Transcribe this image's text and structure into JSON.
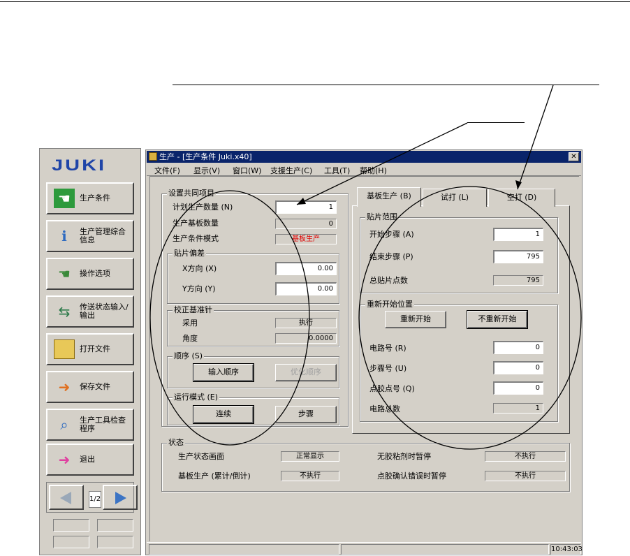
{
  "sidebar": {
    "logo": "JUKI",
    "buttons": [
      {
        "label": "生产条件",
        "icon": "production-conditions-icon"
      },
      {
        "label": "生产管理综合信息",
        "icon": "production-info-icon"
      },
      {
        "label": "操作选项",
        "icon": "operation-options-icon"
      },
      {
        "label": "传送状态输入/输出",
        "icon": "transfer-status-icon"
      },
      {
        "label": "打开文件",
        "icon": "folder-open-icon"
      },
      {
        "label": "保存文件",
        "icon": "save-file-icon"
      },
      {
        "label": "生产工具检查程序",
        "icon": "tool-check-icon"
      },
      {
        "label": "退出",
        "icon": "exit-door-icon"
      }
    ],
    "page_indicator": "1/2"
  },
  "window": {
    "title": "生产 - [生产条件 Juki.x40]",
    "menu": [
      "文件(F)",
      "显示(V)",
      "窗口(W)",
      "支援生产(C)",
      "工具(T)",
      "帮助(H)"
    ]
  },
  "common": {
    "title": "设置共同项目",
    "planned_qty_label": "计划生产数量 (N)",
    "planned_qty_value": "1",
    "board_qty_label": "生产基板数量",
    "board_qty_value": "0",
    "mode_label": "生产条件模式",
    "mode_value": "基板生产",
    "mode_color": "#e00000",
    "offset": {
      "title": "贴片偏差",
      "x_label": "X方向 (X)",
      "x_value": "0.00",
      "y_label": "Y方向 (Y)",
      "y_value": "0.00"
    },
    "pin": {
      "title": "校正基准针",
      "use_label": "采用",
      "use_value": "执行",
      "angle_label": "角度",
      "angle_value": "0.0000"
    },
    "order": {
      "title": "顺序 (S)",
      "input_btn": "输入顺序",
      "optimize_btn": "优化顺序"
    },
    "run_mode": {
      "title": "运行模式 (E)",
      "continuous_btn": "连续",
      "step_btn": "步骤"
    }
  },
  "tabs": [
    "基板生产 (B)",
    "试打 (L)",
    "空打 (D)"
  ],
  "placement": {
    "range_title": "贴片范围",
    "start_label": "开始步骤 (A)",
    "start_value": "1",
    "end_label": "结束步骤 (P)",
    "end_value": "795",
    "total_label": "总贴片点数",
    "total_value": "795",
    "restart_title": "重新开始位置",
    "restart_btn": "重新开始",
    "no_restart_btn": "不重新开始",
    "circuit_label": "电路号 (R)",
    "circuit_value": "0",
    "step_label": "步骤号 (U)",
    "step_value": "0",
    "dispense_label": "点胶点号 (Q)",
    "dispense_value": "0",
    "circuit_total_label": "电路总数",
    "circuit_total_value": "1"
  },
  "status": {
    "title": "状态",
    "screen_label": "生产状态画面",
    "screen_value": "正常显示",
    "no_glue_label": "无胶粘剂时暂停",
    "no_glue_value": "不执行",
    "board_label": "基板生产 (累计/倒计)",
    "board_value": "不执行",
    "glue_err_label": "点胶确认错误时暂停",
    "glue_err_value": "不执行"
  },
  "statusbar": {
    "time": "10:43:03"
  }
}
